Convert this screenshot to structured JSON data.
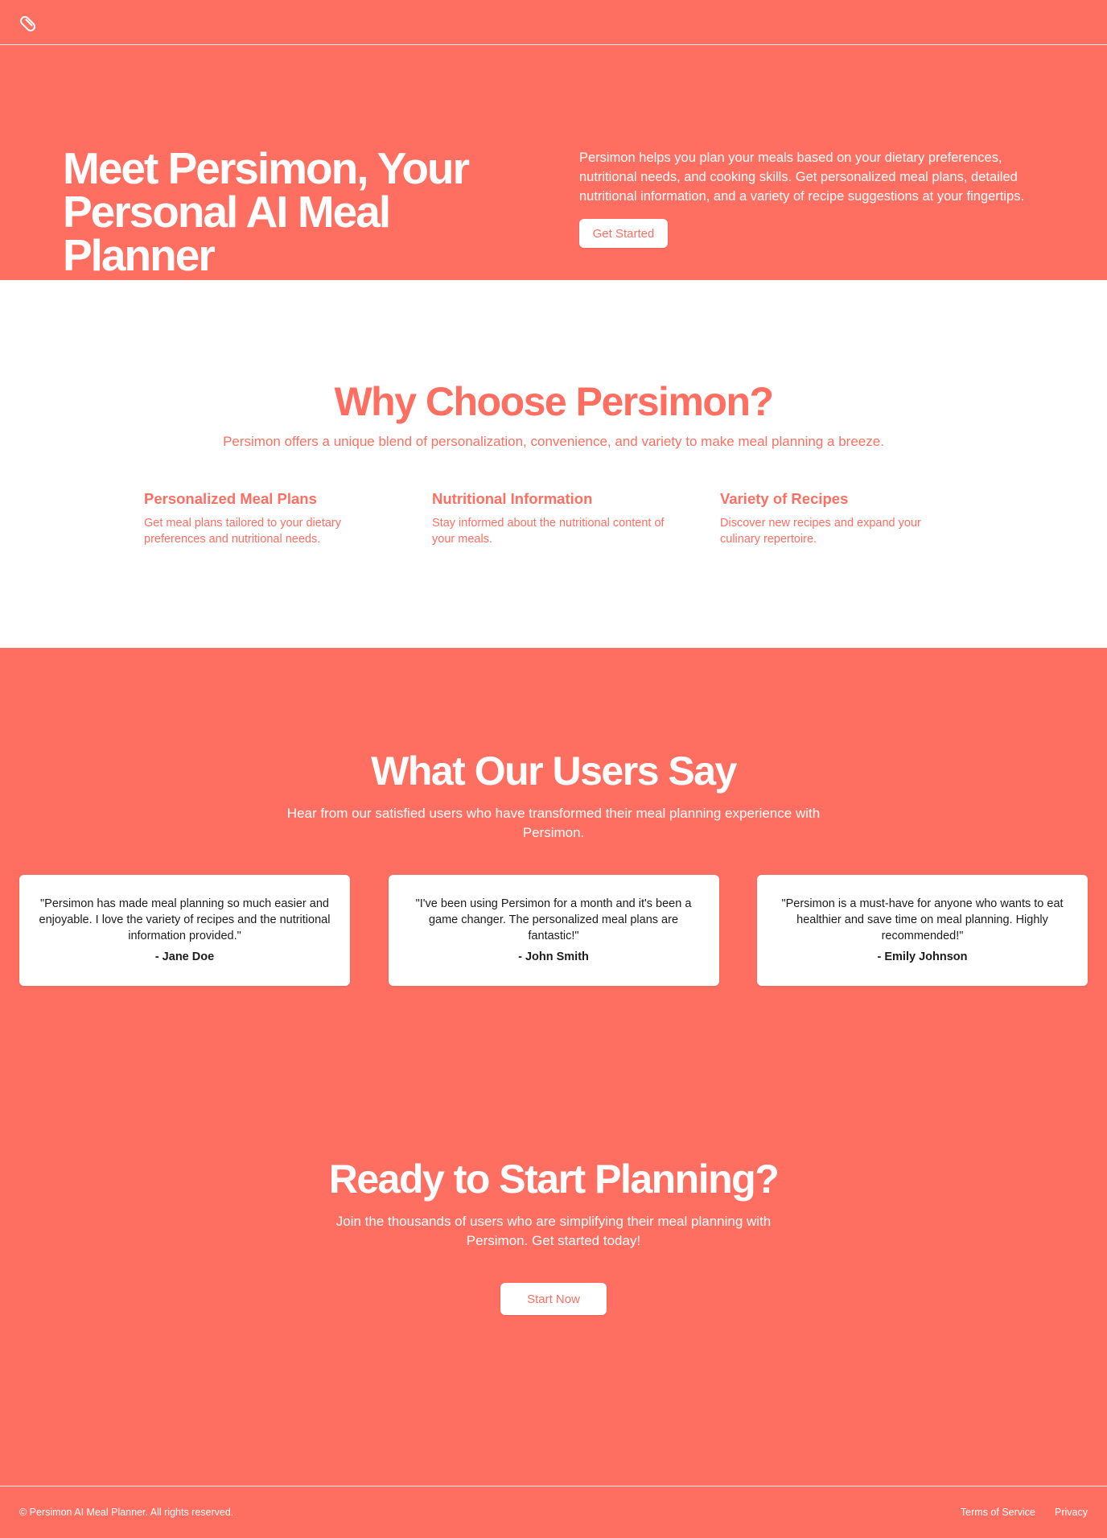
{
  "header": {
    "logo_icon": "pill-icon"
  },
  "hero": {
    "title": "Meet Persimon, Your Personal AI Meal Planner",
    "description": "Persimon helps you plan your meals based on your dietary preferences, nutritional needs, and cooking skills. Get personalized meal plans, detailed nutritional information, and a variety of recipe suggestions at your fingertips.",
    "cta_label": "Get Started"
  },
  "features": {
    "title": "Why Choose Persimon?",
    "subtitle": "Persimon offers a unique blend of personalization, convenience, and variety to make meal planning a breeze.",
    "items": [
      {
        "title": "Personalized Meal Plans",
        "description": "Get meal plans tailored to your dietary preferences and nutritional needs."
      },
      {
        "title": "Nutritional Information",
        "description": "Stay informed about the nutritional content of your meals."
      },
      {
        "title": "Variety of Recipes",
        "description": "Discover new recipes and expand your culinary repertoire."
      }
    ]
  },
  "testimonials": {
    "title": "What Our Users Say",
    "subtitle": "Hear from our satisfied users who have transformed their meal planning experience with Persimon.",
    "items": [
      {
        "quote": "\"Persimon has made meal planning so much easier and enjoyable. I love the variety of recipes and the nutritional information provided.\"",
        "author": "- Jane Doe"
      },
      {
        "quote": "\"I've been using Persimon for a month and it's been a game changer. The personalized meal plans are fantastic!\"",
        "author": "- John Smith"
      },
      {
        "quote": "\"Persimon is a must-have for anyone who wants to eat healthier and save time on meal planning. Highly recommended!\"",
        "author": "- Emily Johnson"
      }
    ]
  },
  "cta": {
    "title": "Ready to Start Planning?",
    "subtitle": "Join the thousands of users who are simplifying their meal planning with Persimon. Get started today!",
    "button_label": "Start Now"
  },
  "footer": {
    "copyright": "© Persimon AI Meal Planner. All rights reserved.",
    "links": [
      "Terms of Service",
      "Privacy"
    ]
  },
  "colors": {
    "brand": "#ff6f61",
    "surface": "#ffffff",
    "card_text": "#1c1c1c"
  }
}
